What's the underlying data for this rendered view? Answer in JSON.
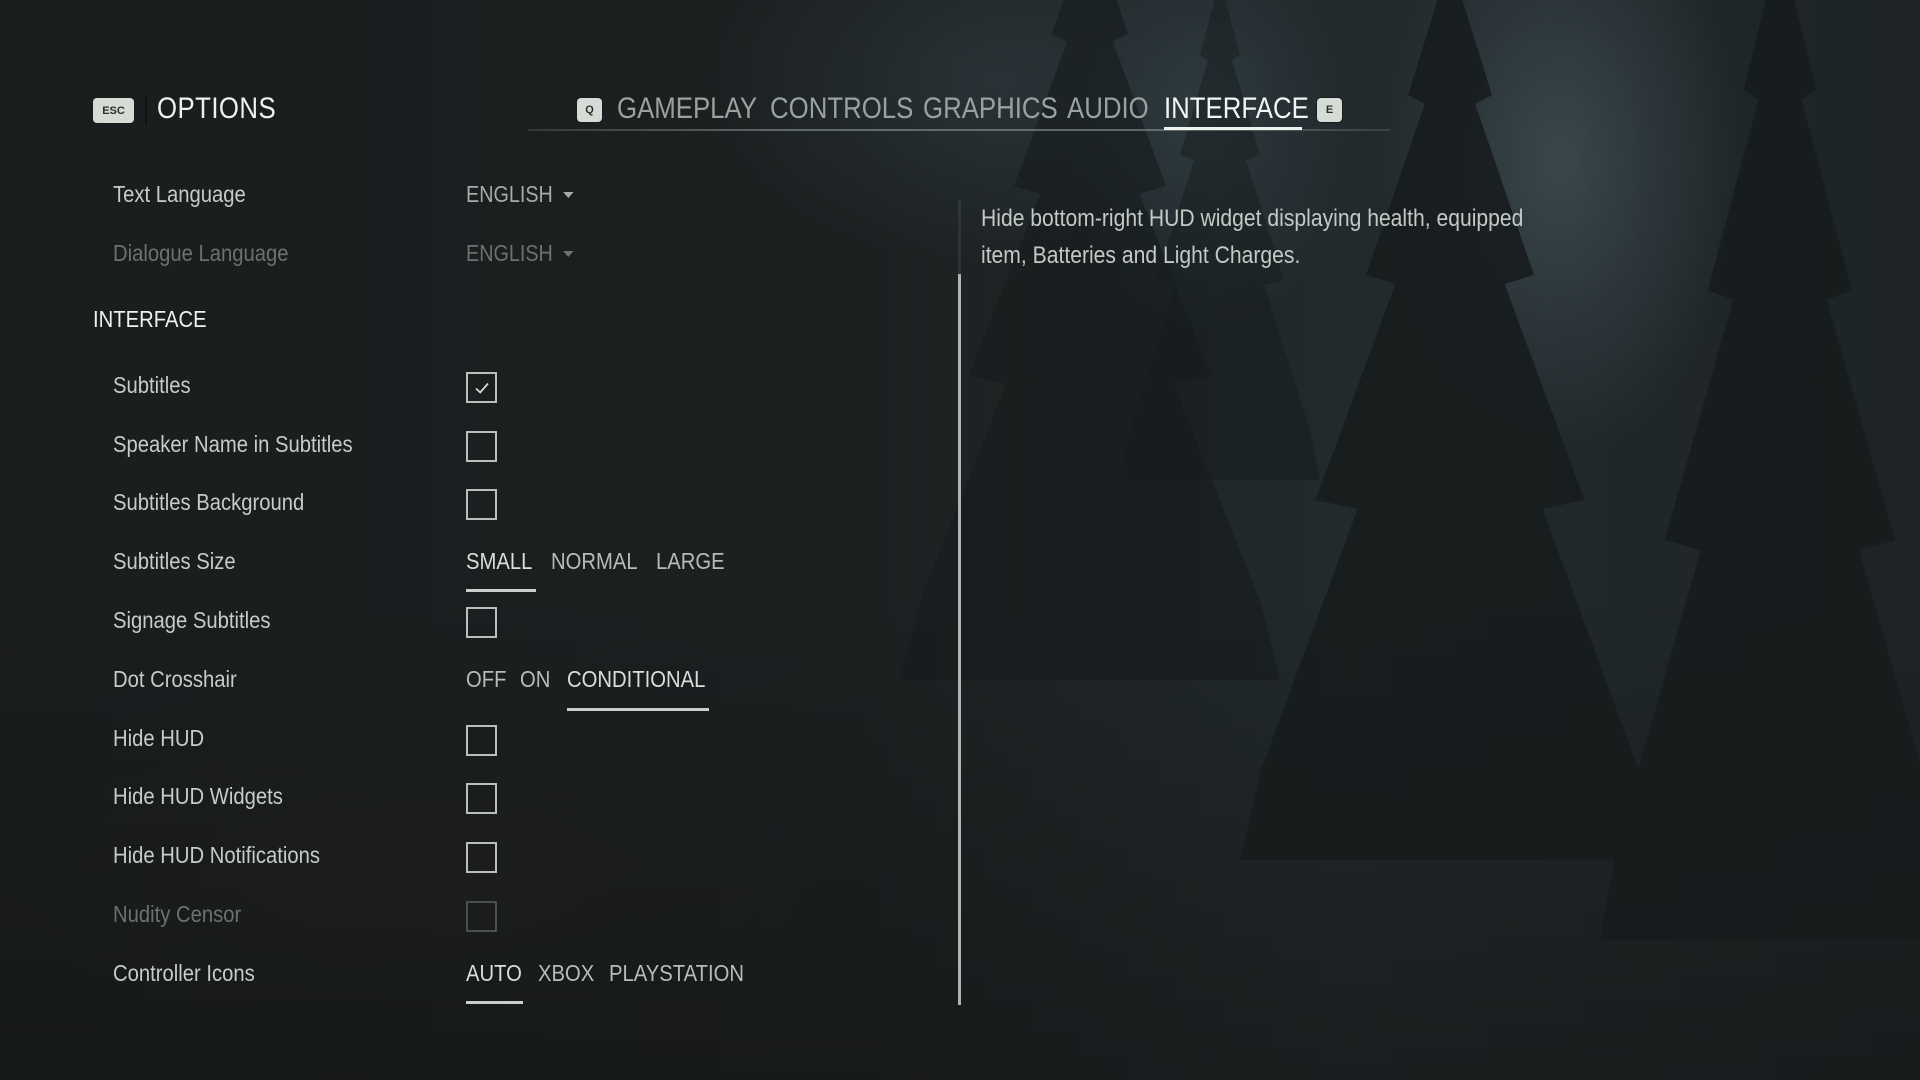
{
  "header": {
    "back_key": "ESC",
    "title": "OPTIONS"
  },
  "tabs": {
    "prev_key": "Q",
    "next_key": "E",
    "items": [
      {
        "label": "GAMEPLAY",
        "active": false
      },
      {
        "label": "CONTROLS",
        "active": false
      },
      {
        "label": "GRAPHICS",
        "active": false
      },
      {
        "label": "AUDIO",
        "active": false
      },
      {
        "label": "INTERFACE",
        "active": true
      }
    ]
  },
  "language": {
    "text_language": {
      "label": "Text Language",
      "value": "ENGLISH"
    },
    "dialogue_language": {
      "label": "Dialogue Language",
      "value": "ENGLISH",
      "disabled": true
    }
  },
  "interface": {
    "section_title": "INTERFACE",
    "subtitles": {
      "label": "Subtitles",
      "checked": true
    },
    "speaker_name": {
      "label": "Speaker Name in Subtitles",
      "checked": false
    },
    "subtitles_background": {
      "label": "Subtitles Background",
      "checked": false
    },
    "subtitles_size": {
      "label": "Subtitles Size",
      "options": [
        "SMALL",
        "NORMAL",
        "LARGE"
      ],
      "selected": "SMALL"
    },
    "signage_subtitles": {
      "label": "Signage Subtitles",
      "checked": false
    },
    "dot_crosshair": {
      "label": "Dot Crosshair",
      "options": [
        "OFF",
        "ON",
        "CONDITIONAL"
      ],
      "selected": "CONDITIONAL"
    },
    "hide_hud": {
      "label": "Hide HUD",
      "checked": false
    },
    "hide_hud_widgets": {
      "label": "Hide HUD Widgets",
      "checked": false
    },
    "hide_hud_notifications": {
      "label": "Hide HUD Notifications",
      "checked": false
    },
    "nudity_censor": {
      "label": "Nudity Censor",
      "checked": false,
      "disabled": true
    },
    "controller_icons": {
      "label": "Controller Icons",
      "options": [
        "AUTO",
        "XBOX",
        "PLAYSTATION"
      ],
      "selected": "AUTO"
    }
  },
  "description": {
    "line1": "Hide bottom-right HUD widget displaying health, equipped",
    "line2": "item, Batteries and Light Charges."
  },
  "colors": {
    "text_primary": "#eef2ee",
    "text_secondary": "#c6ccc8",
    "text_disabled": "#6b7270",
    "key_background": "#d5dcd6",
    "background": "#1b1f20"
  }
}
